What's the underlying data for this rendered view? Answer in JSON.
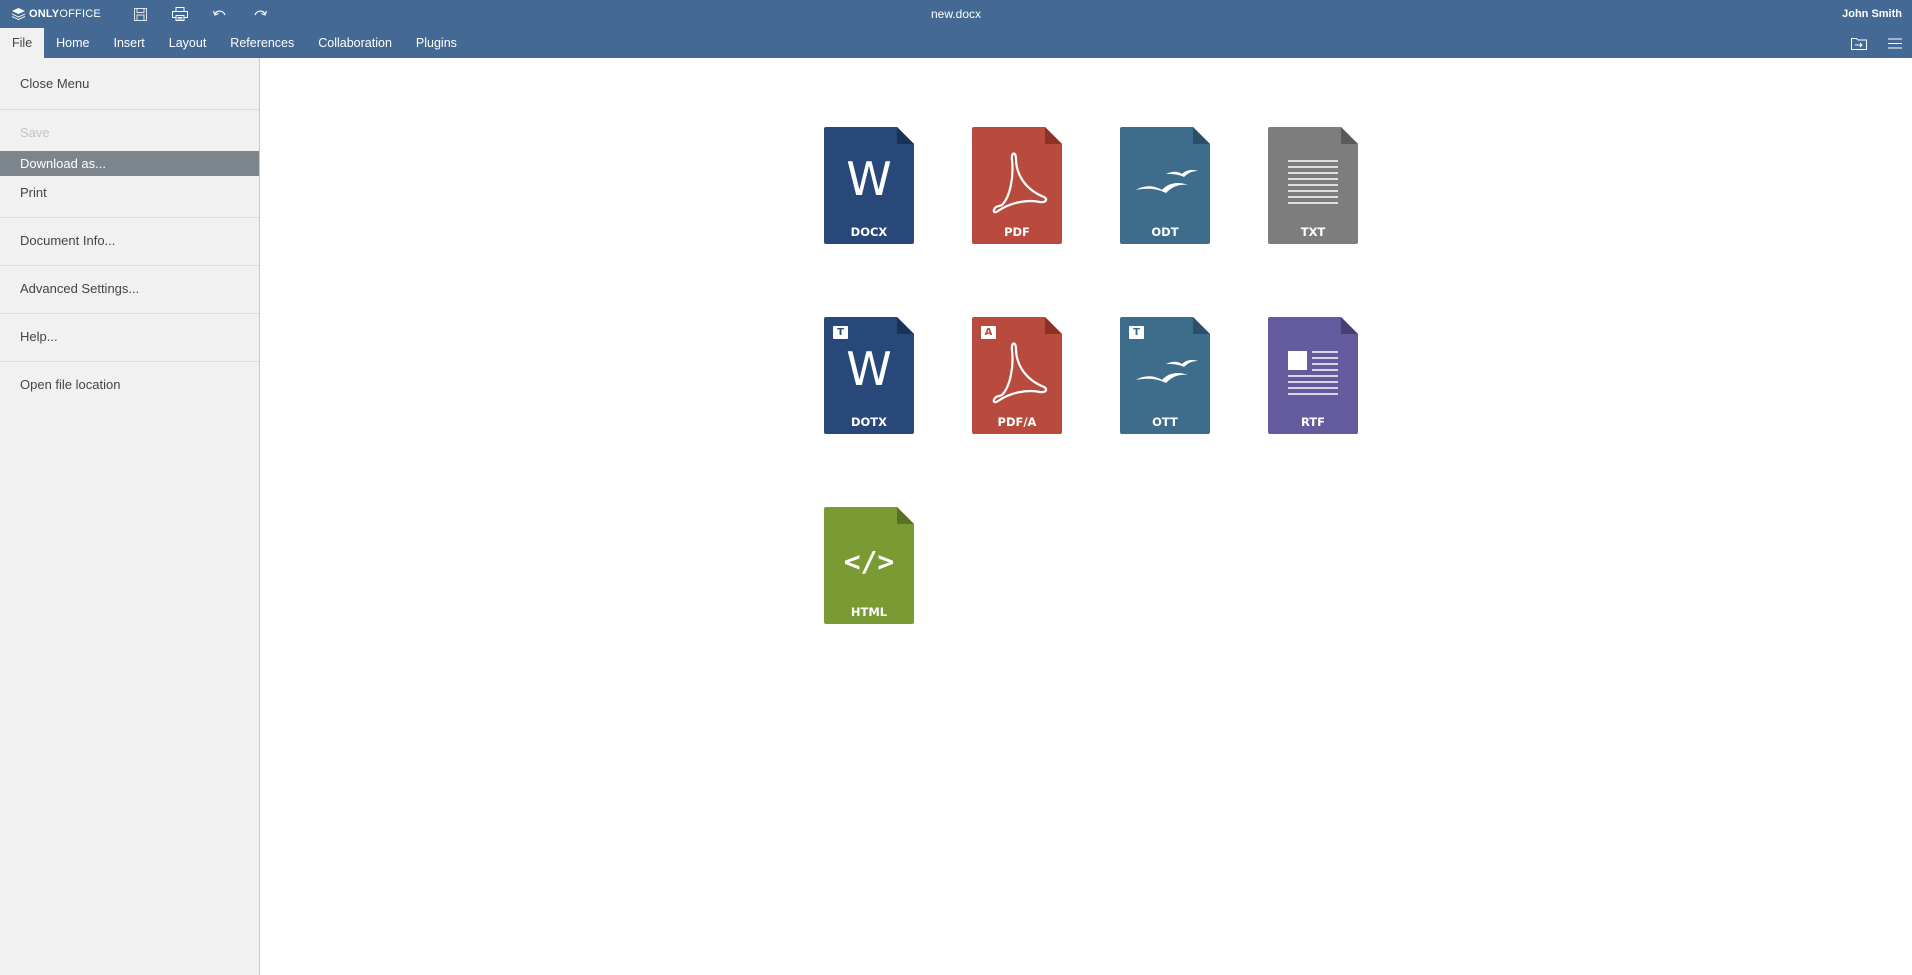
{
  "app": {
    "brand_bold": "ONLY",
    "brand_thin": "OFFICE",
    "document_title": "new.docx",
    "user_name": "John Smith"
  },
  "quick_tools": [
    {
      "name": "save-icon"
    },
    {
      "name": "print-icon"
    },
    {
      "name": "undo-icon"
    },
    {
      "name": "redo-icon"
    }
  ],
  "tabs": [
    {
      "label": "File",
      "active": true
    },
    {
      "label": "Home"
    },
    {
      "label": "Insert"
    },
    {
      "label": "Layout"
    },
    {
      "label": "References"
    },
    {
      "label": "Collaboration"
    },
    {
      "label": "Plugins"
    }
  ],
  "file_menu": {
    "close": "Close Menu",
    "save": "Save",
    "download_as": "Download as...",
    "print": "Print",
    "document_info": "Document Info...",
    "advanced_settings": "Advanced Settings...",
    "help": "Help...",
    "open_location": "Open file location"
  },
  "formats": [
    {
      "label": "DOCX",
      "color": "#274879",
      "corner": "#1a3257",
      "glyph": "W"
    },
    {
      "label": "PDF",
      "color": "#b84a3e",
      "corner": "#8b3128",
      "glyph": "pdf"
    },
    {
      "label": "ODT",
      "color": "#3e6d8c",
      "corner": "#2b4f68",
      "glyph": "gulls"
    },
    {
      "label": "TXT",
      "color": "#7d7d7d",
      "corner": "#5a5a5a",
      "glyph": "lines"
    },
    {
      "label": "DOTX",
      "color": "#274879",
      "corner": "#1a3257",
      "glyph": "W",
      "badge": "T"
    },
    {
      "label": "PDF/A",
      "color": "#b84a3e",
      "corner": "#8b3128",
      "glyph": "pdf",
      "badge": "A"
    },
    {
      "label": "OTT",
      "color": "#3e6d8c",
      "corner": "#2b4f68",
      "glyph": "gulls",
      "badge": "T"
    },
    {
      "label": "RTF",
      "color": "#645b9e",
      "corner": "#463f73",
      "glyph": "rtf"
    },
    {
      "label": "HTML",
      "color": "#7a9a33",
      "corner": "#587224",
      "glyph": "code"
    }
  ],
  "colors": {
    "header": "#446995",
    "menu_bg": "#f1f1f1",
    "menu_active": "#7d858c"
  }
}
